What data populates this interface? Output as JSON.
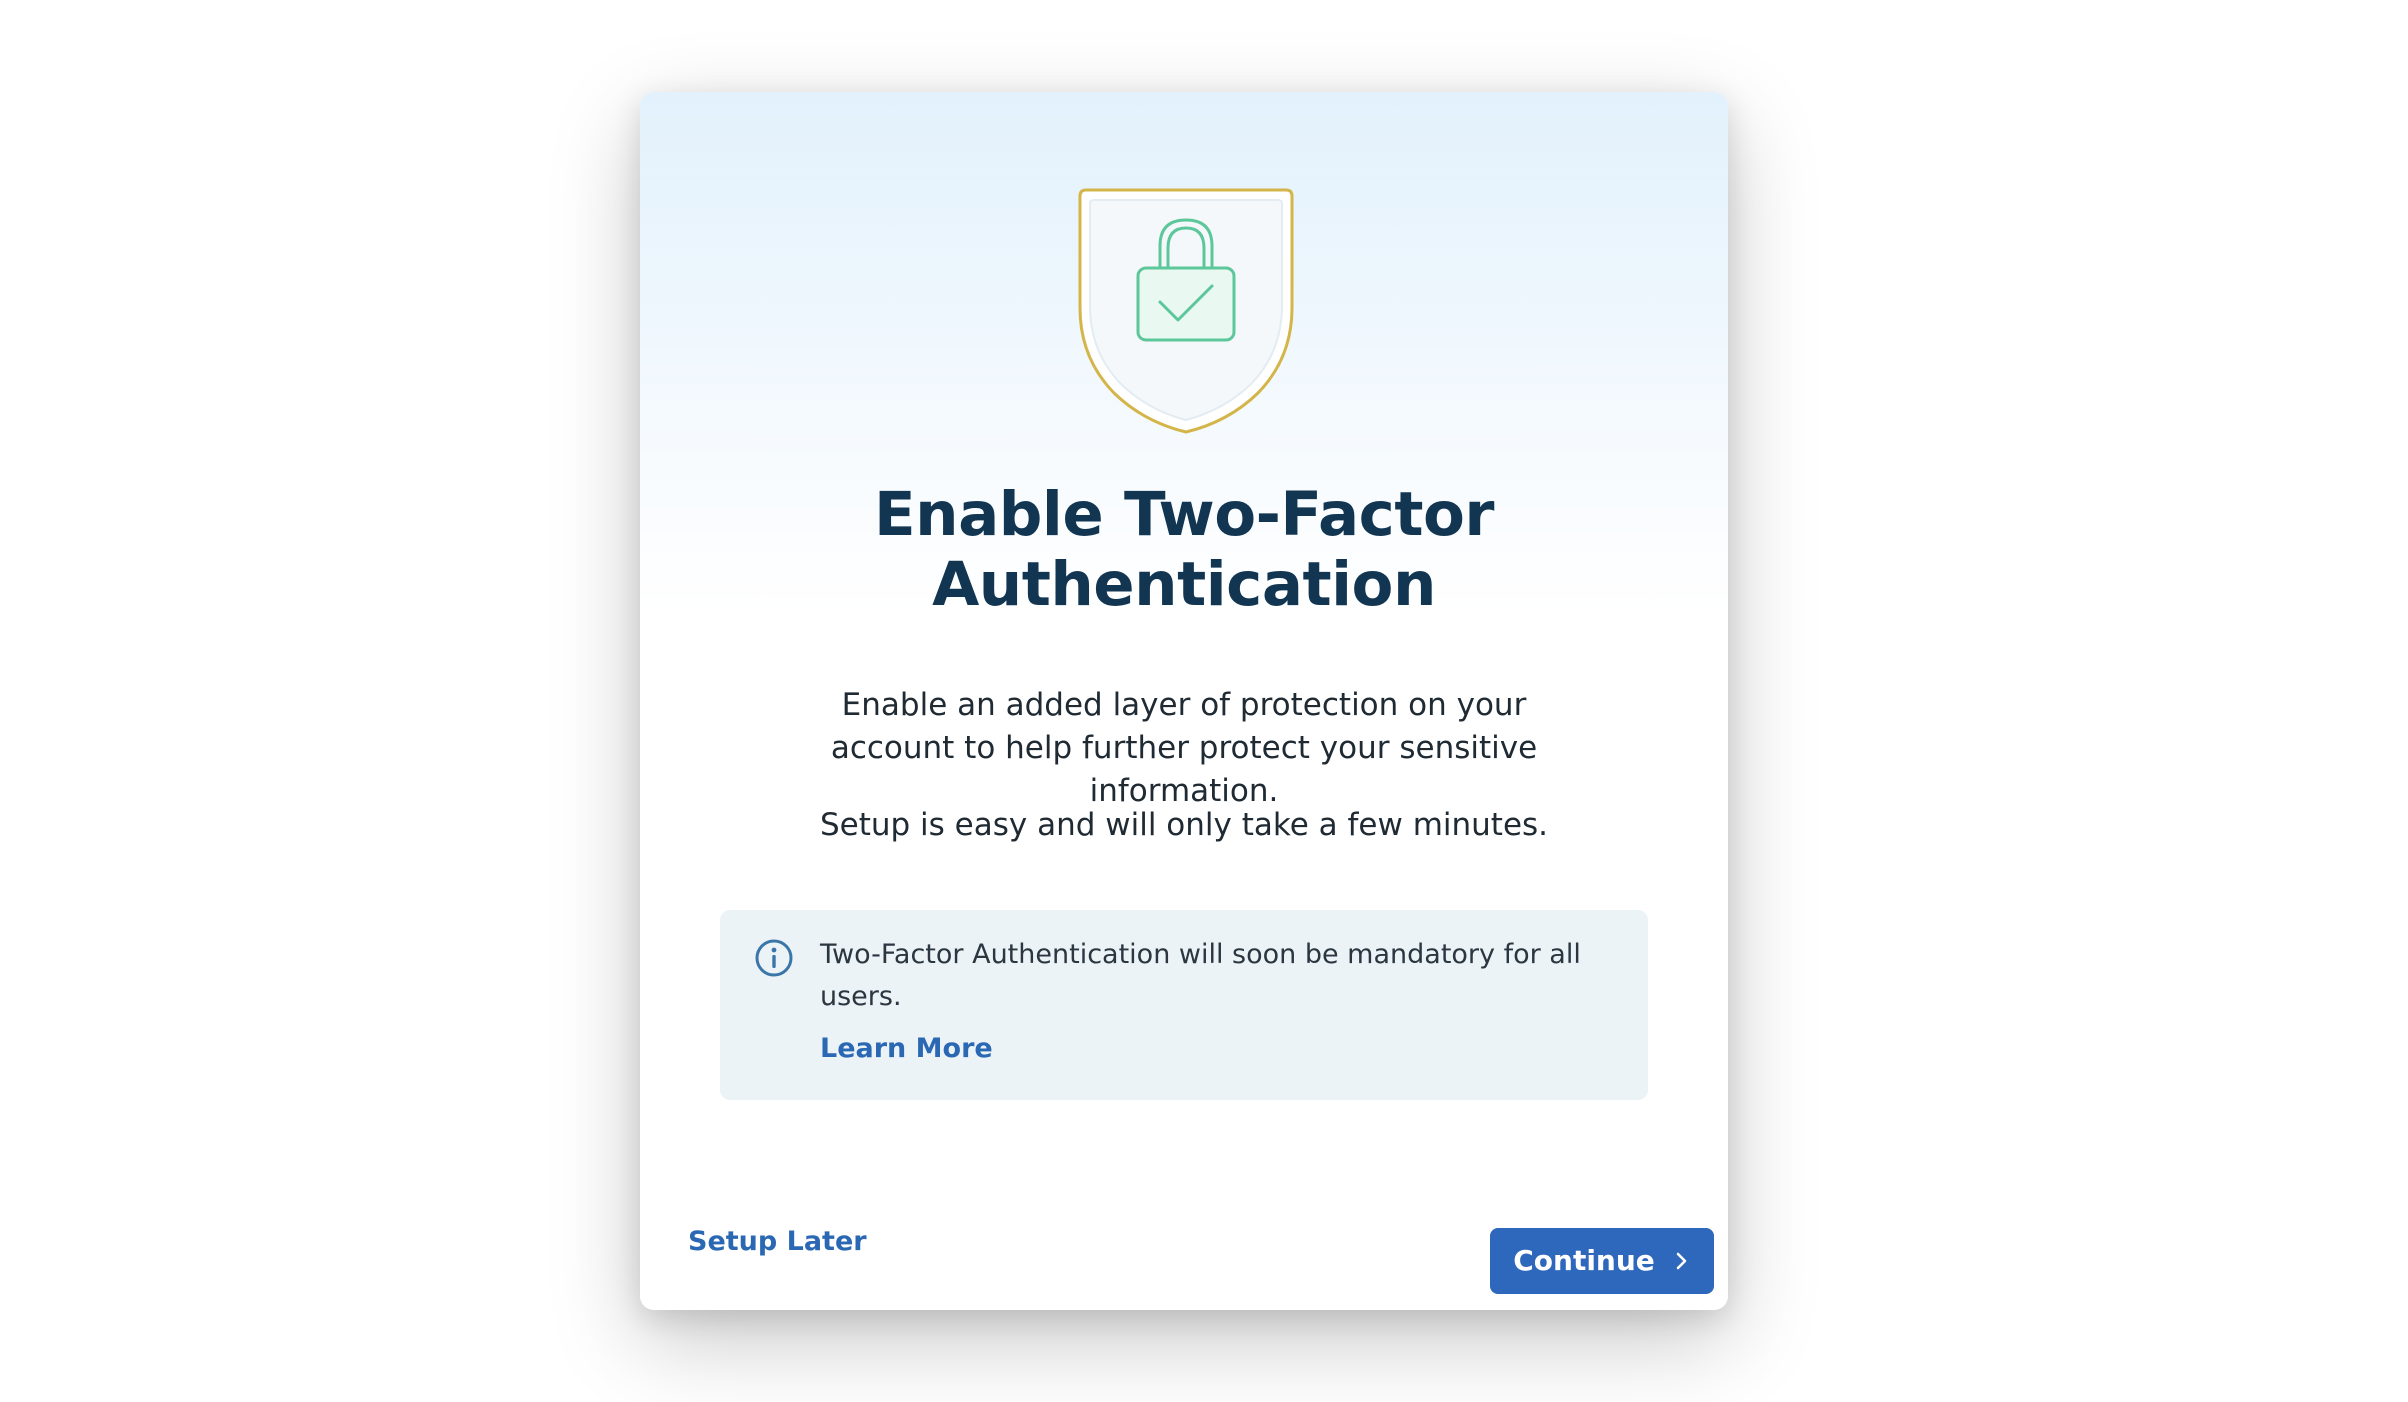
{
  "modal": {
    "title": "Enable Two-Factor Authentication",
    "description_1": "Enable an added layer of protection on your account to help further protect your sensitive information.",
    "description_2": "Setup is easy and will only take a few minutes.",
    "hero_icon": "shield-lock-check-icon",
    "notice": {
      "icon": "info-icon",
      "text": "Two-Factor Authentication will soon be mandatory for all users.",
      "link_label": "Learn More"
    },
    "footer": {
      "secondary_label": "Setup Later",
      "primary_label": "Continue",
      "primary_icon": "chevron-right-icon"
    }
  },
  "colors": {
    "title": "#123552",
    "accent": "#2d68bd",
    "link": "#2b68b4",
    "notice_bg": "#ecf3f7",
    "shield_border": "#d4b54a",
    "lock_green": "#5cc79a"
  }
}
